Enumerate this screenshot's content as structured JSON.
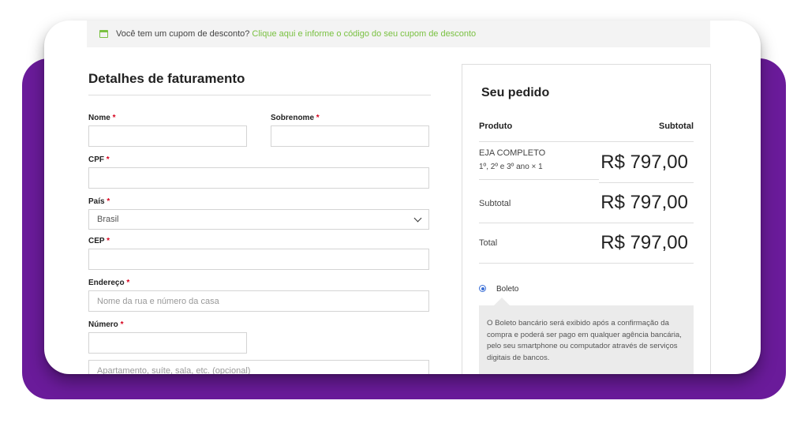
{
  "coupon": {
    "text": "Você tem um cupom de desconto?",
    "link": "Clique aqui e informe o código do seu cupom de desconto"
  },
  "billing": {
    "title": "Detalhes de faturamento",
    "required_mark": "*",
    "fields": {
      "nome": {
        "label": "Nome",
        "value": ""
      },
      "sobrenome": {
        "label": "Sobrenome",
        "value": ""
      },
      "cpf": {
        "label": "CPF",
        "value": ""
      },
      "pais": {
        "label": "País",
        "value": "Brasil"
      },
      "cep": {
        "label": "CEP",
        "value": ""
      },
      "endereco": {
        "label": "Endereço",
        "placeholder": "Nome da rua e número da casa"
      },
      "numero": {
        "label": "Número",
        "value": ""
      },
      "complemento": {
        "placeholder": "Apartamento, suíte, sala, etc. (opcional)"
      }
    }
  },
  "order": {
    "title": "Seu pedido",
    "col_product": "Produto",
    "col_subtotal": "Subtotal",
    "product_name": "EJA COMPLETO",
    "product_meta": "1º, 2º e 3º ano × 1",
    "product_price": "R$ 797,00",
    "subtotal_label": "Subtotal",
    "subtotal_value": "R$ 797,00",
    "total_label": "Total",
    "total_value": "R$ 797,00",
    "payment": {
      "selected": true,
      "label": "Boleto",
      "description": "O Boleto bancário será exibido após a confirmação da compra e poderá ser pago em qualquer agência bancária, pelo seu smartphone ou computador através de serviços digitais de bancos."
    }
  },
  "colors": {
    "accent": "#7ac142",
    "background_band": "#6a1b9a",
    "required": "#d6001c"
  },
  "icons": {
    "coupon": "coupon-icon",
    "select": "chevron-down-icon",
    "payment": "radio-selected"
  }
}
